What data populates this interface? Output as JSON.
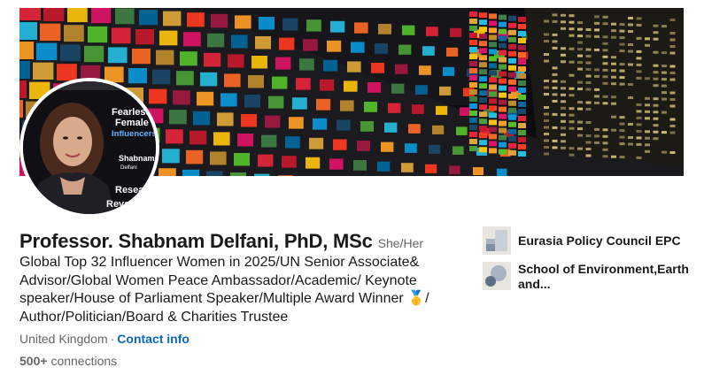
{
  "profile": {
    "name": "Professor. Shabnam Delfani, PhD, MSc",
    "pronouns": "She/Her",
    "headline": "Global Top 32 Influencer Women in 2025/UN Senior Associate& Advisor/Global Women Peace Ambassador/Academic/ Keynote speaker/House of Parliament Speaker/Multiple Award Winner 🥇/ Author/Politician/Board & Charities Trustee",
    "location": "United Kingdom",
    "separator": "·",
    "contact_label": "Contact info",
    "connections_count": "500+",
    "connections_label": "connections"
  },
  "avatar_card": {
    "line1": "Fearless",
    "line2": "Female",
    "line3": "Influencers",
    "name1": "Shabnam",
    "name2": "Delfani",
    "word1": "Research",
    "word2": "Revolutio"
  },
  "organizations": [
    {
      "name": "Eurasia Policy Council EPC",
      "logo_icon": "company-logo-icon"
    },
    {
      "name": "School of Environment,Earth and...",
      "logo_icon": "school-logo-icon"
    }
  ],
  "colors": {
    "link": "#0a66c2",
    "text_primary": "#191919",
    "text_secondary": "#666666"
  }
}
